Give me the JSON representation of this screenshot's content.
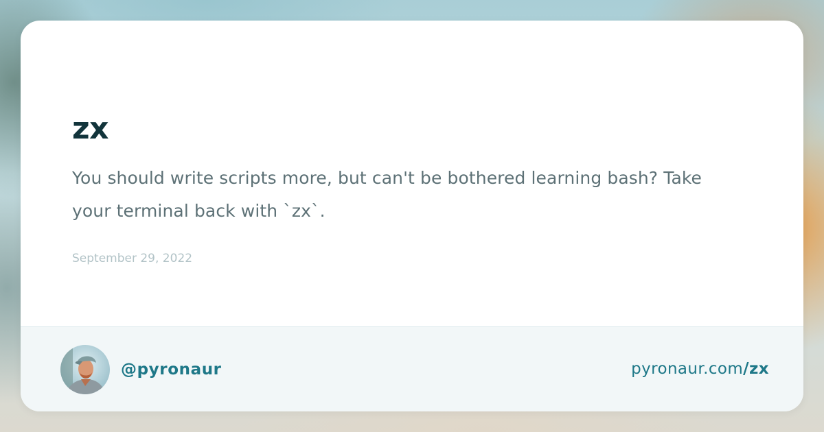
{
  "post": {
    "title": "zx",
    "description": "You should write scripts more, but can't be bothered learning bash? Take your terminal back with `zx`.",
    "date": "September 29, 2022"
  },
  "author": {
    "handle": "@pyronaur"
  },
  "link": {
    "domain": "pyronaur.com",
    "slug": "/zx"
  },
  "colors": {
    "title": "#12343b",
    "description": "#5d7176",
    "date": "#b2c3c7",
    "accent": "#1e7888",
    "footer_background": "#f2f7f8"
  }
}
